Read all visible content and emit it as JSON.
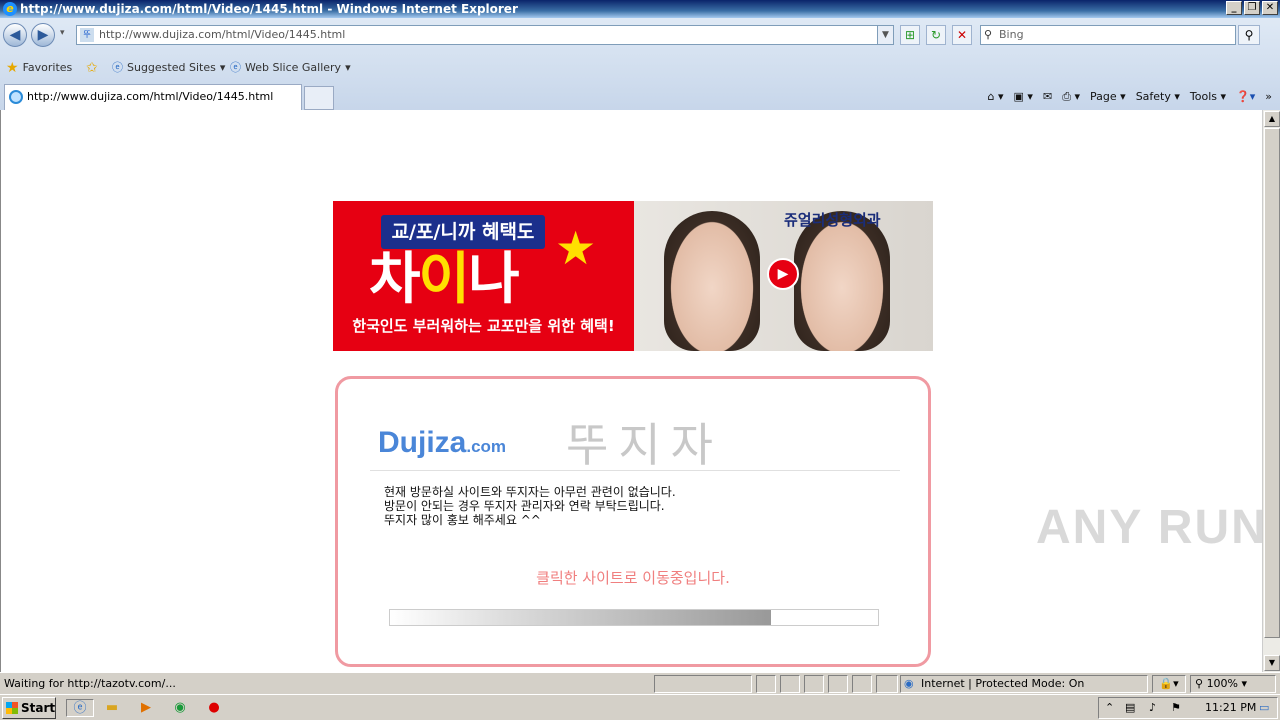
{
  "window": {
    "title": "http://www.dujiza.com/html/Video/1445.html - Windows Internet Explorer"
  },
  "address": {
    "url": "http://www.dujiza.com/html/Video/1445.html"
  },
  "search": {
    "placeholder": "Bing"
  },
  "favorites_bar": {
    "favorites_label": "Favorites",
    "suggested_label": "Suggested Sites",
    "gallery_label": "Web Slice Gallery"
  },
  "tab": {
    "title": "http://www.dujiza.com/html/Video/1445.html"
  },
  "command_bar": {
    "page": "Page",
    "safety": "Safety",
    "tools": "Tools"
  },
  "banner": {
    "badge": "교/포/니까 혜택도",
    "headline_white": "차",
    "headline_yellow": "이",
    "headline_rest": "나",
    "subline": "한국인도 부러워하는 교포만을 위한 혜택!",
    "clinic": "쥬얼리성형외과"
  },
  "notice": {
    "logo_main": "Dujiza",
    "logo_suffix": ".com",
    "brand_kr": "뚜지자",
    "line1": "현재 방문하실 사이트와 뚜지자는 아무런 관련이 없습니다.",
    "line2": "방문이 안되는 경우 뚜지자 관리자와 연락 부탁드립니다.",
    "line3": "뚜지자 많이 홍보 해주세요 ^^",
    "moving": "클릭한 사이트로 이동중입니다.",
    "progress": 0.78
  },
  "watermark": "ANY RUN",
  "status": {
    "left": "Waiting for http://tazotv.com/...",
    "zone": "Internet | Protected Mode: On",
    "zoom": "100%"
  },
  "taskbar": {
    "start": "Start",
    "clock": "11:21 PM"
  }
}
